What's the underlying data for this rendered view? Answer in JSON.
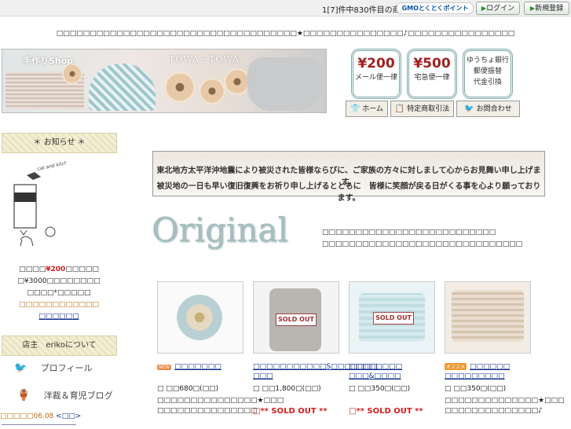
{
  "topbar": {
    "counter": "1[7]件中830件目の商品です",
    "gmo_label": "GMOとくとくポイント",
    "login_label": "ログイン",
    "register_label": "新規登録"
  },
  "message": "□□□□□□□□□□□□□□□□□□□□□□□□□□□□□□□□□□□□★□□□□□□□□□□□□□□□♪□□□□□□□□□□□□□□□□",
  "banner": {
    "shop": "手作りShop",
    "brand": "TOWA・TOWA"
  },
  "badges": [
    {
      "price": "¥200",
      "sub": "メール便一律"
    },
    {
      "price": "¥500",
      "sub": "宅急便一律"
    }
  ],
  "badge3": [
    "ゆうちょ銀行",
    "郵便振替",
    "代金引換"
  ],
  "nav": {
    "home": "ホーム",
    "law": "特定商取引法",
    "contact": "お問合わせ"
  },
  "sidebar": {
    "news_head": "＊ お知らせ ＊",
    "logo_text": "cat and kitchen",
    "line1_pre": "□□□□",
    "line1_price": "¥200",
    "line1_post": "□□□□□",
    "line2": "□¥3000□□□□□□□□",
    "line3": "□□□□*□□□□□",
    "line4": "□□□□□□□□□□□□",
    "line5": "□□□□□□",
    "owner_head": "店主　erikoについて",
    "profile": "プロフィール",
    "blog": "洋裁＆育児ブログ",
    "date": "□□□□□06.08",
    "date_link": "<□□>"
  },
  "notice": {
    "line1": "東北地方太平洋沖地震により被災された皆様ならびに、ご家族の方々に対しまして心からお見舞い申し上げます。",
    "line2": "被災地の一日も早い復旧復興をお祈り申し上げるとともに　皆様に笑顔が戻る日がくる事を心より願っております。"
  },
  "original": {
    "title": "Original",
    "text1": "□□□□□□□□□□□□□□□□□□□□□□□□□□",
    "text2": "□□□□□□□□□□□□□□□□□□□□□□□□□□□□□□"
  },
  "products": [
    {
      "badge": "NEW",
      "name1": "□□□□□□□",
      "name2": "",
      "price": "□ □□680□(□□)",
      "desc1": "□□□□□□□□□□□□□□□★□□□",
      "desc2": "□□□□□□□□□□□□□□□",
      "sold": "",
      "soldtag": ""
    },
    {
      "badge": "",
      "name1": "□□□□□□□□□□□S□□□□□□□",
      "name2": "□□□",
      "price": "□ □□1,800□(□□)",
      "desc1": "",
      "desc2": "",
      "sold": "□** SOLD OUT **",
      "soldtag": "SOLD OUT"
    },
    {
      "badge": "",
      "name1": "□□□□□□□□",
      "name2": "□□□&□□□□",
      "price": "□ □□350□(□□)",
      "desc1": "",
      "desc2": "",
      "sold": "□** SOLD OUT **",
      "soldtag": "SOLD OUT"
    },
    {
      "badge": "オススメ",
      "name1": "□□□□□□",
      "name2": "□□□□□□□□□",
      "price": "□ □□350□(□□)",
      "desc1": "□□□□□□□□□□□□□□★□□□",
      "desc2": "□□□□□□□□□□□□□□♪",
      "sold": "",
      "soldtag": ""
    }
  ],
  "colors": {
    "accent": "#a02020",
    "sold_out": "#d02020",
    "link": "#0a2a8a",
    "sidebar_price": "#cc2020"
  }
}
